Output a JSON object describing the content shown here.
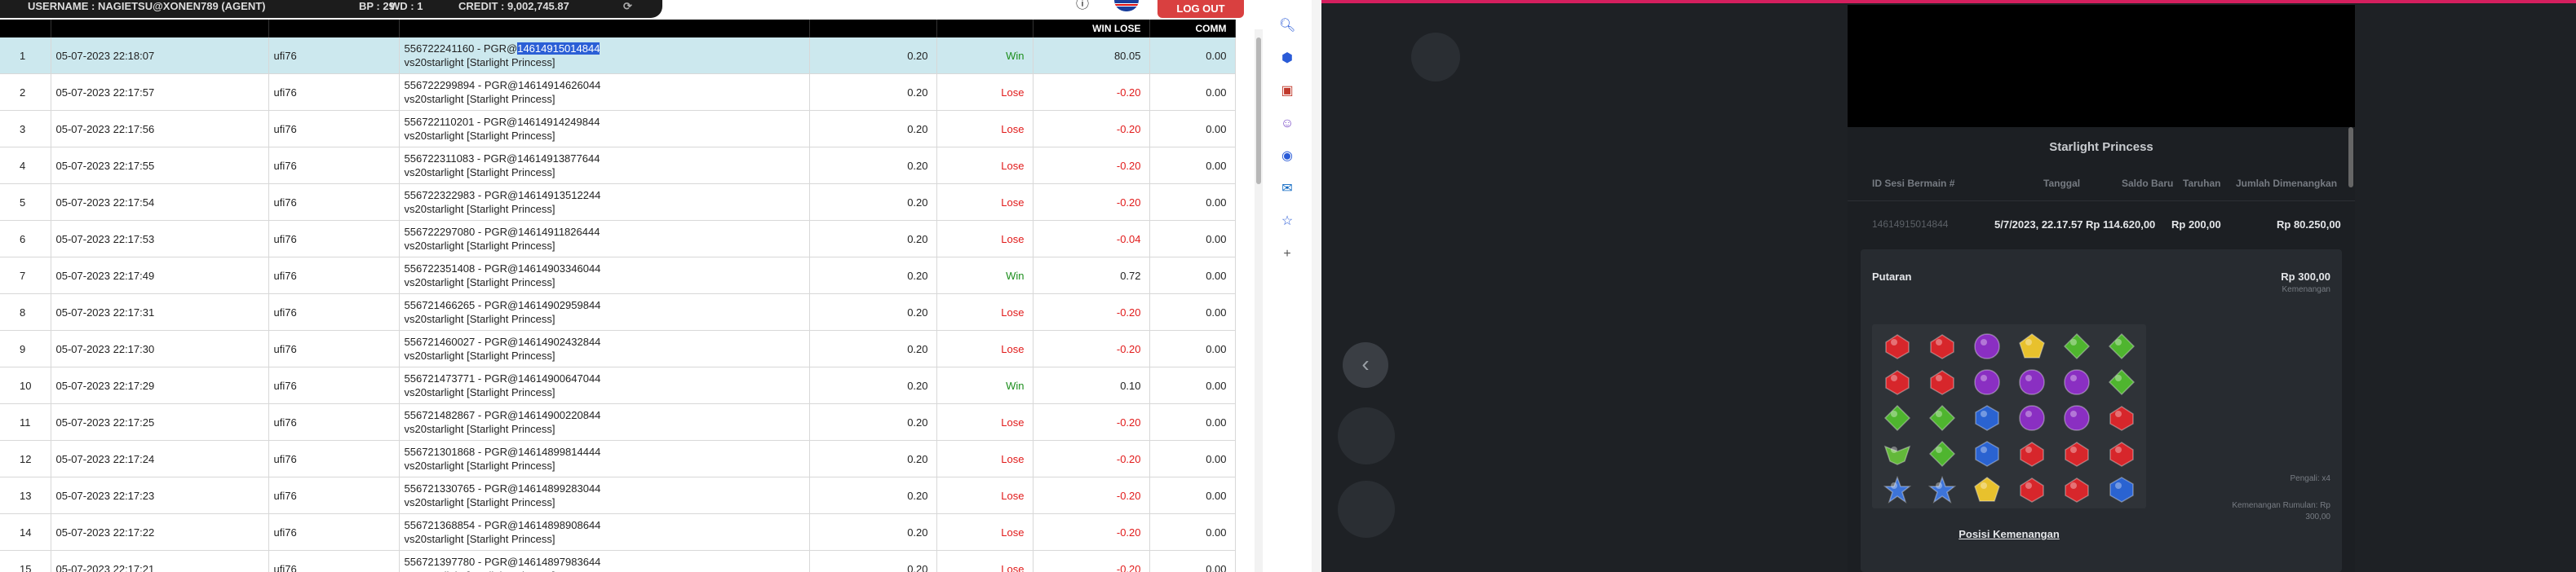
{
  "topbar": {
    "username": "USERNAME : NAGIETSU@XONEN789 (AGENT)",
    "bp": "BP : 29",
    "wd": "WD : 1",
    "credit": "CREDIT : 9,002,745.87",
    "logout_label": "LOG OUT"
  },
  "table": {
    "headers": [
      "",
      "",
      "",
      "",
      "",
      "",
      "WIN LOSE",
      "COMM"
    ],
    "rows": [
      {
        "no": "1",
        "date": "05-07-2023 22:18:07",
        "user": "ufi76",
        "txn_prefix": "556722241160 - PGR@",
        "txn_hl": "14614915014844",
        "game": "vs20starlight [Starlight Princess]",
        "bet": "0.20",
        "result": "Win",
        "winlose": "80.05",
        "comm": "0.00"
      },
      {
        "no": "2",
        "date": "05-07-2023 22:17:57",
        "user": "ufi76",
        "txn": "556722299894 - PGR@14614914626044",
        "game": "vs20starlight [Starlight Princess]",
        "bet": "0.20",
        "result": "Lose",
        "winlose": "-0.20",
        "comm": "0.00"
      },
      {
        "no": "3",
        "date": "05-07-2023 22:17:56",
        "user": "ufi76",
        "txn": "556722110201 - PGR@14614914249844",
        "game": "vs20starlight [Starlight Princess]",
        "bet": "0.20",
        "result": "Lose",
        "winlose": "-0.20",
        "comm": "0.00"
      },
      {
        "no": "4",
        "date": "05-07-2023 22:17:55",
        "user": "ufi76",
        "txn": "556722311083 - PGR@14614913877644",
        "game": "vs20starlight [Starlight Princess]",
        "bet": "0.20",
        "result": "Lose",
        "winlose": "-0.20",
        "comm": "0.00"
      },
      {
        "no": "5",
        "date": "05-07-2023 22:17:54",
        "user": "ufi76",
        "txn": "556722322983 - PGR@14614913512244",
        "game": "vs20starlight [Starlight Princess]",
        "bet": "0.20",
        "result": "Lose",
        "winlose": "-0.20",
        "comm": "0.00"
      },
      {
        "no": "6",
        "date": "05-07-2023 22:17:53",
        "user": "ufi76",
        "txn": "556722297080 - PGR@14614911826444",
        "game": "vs20starlight [Starlight Princess]",
        "bet": "0.20",
        "result": "Lose",
        "winlose": "-0.04",
        "comm": "0.00"
      },
      {
        "no": "7",
        "date": "05-07-2023 22:17:49",
        "user": "ufi76",
        "txn": "556722351408 - PGR@14614903346044",
        "game": "vs20starlight [Starlight Princess]",
        "bet": "0.20",
        "result": "Win",
        "winlose": "0.72",
        "comm": "0.00"
      },
      {
        "no": "8",
        "date": "05-07-2023 22:17:31",
        "user": "ufi76",
        "txn": "556721466265 - PGR@14614902959844",
        "game": "vs20starlight [Starlight Princess]",
        "bet": "0.20",
        "result": "Lose",
        "winlose": "-0.20",
        "comm": "0.00"
      },
      {
        "no": "9",
        "date": "05-07-2023 22:17:30",
        "user": "ufi76",
        "txn": "556721460027 - PGR@14614902432844",
        "game": "vs20starlight [Starlight Princess]",
        "bet": "0.20",
        "result": "Lose",
        "winlose": "-0.20",
        "comm": "0.00"
      },
      {
        "no": "10",
        "date": "05-07-2023 22:17:29",
        "user": "ufi76",
        "txn": "556721473771 - PGR@14614900647044",
        "game": "vs20starlight [Starlight Princess]",
        "bet": "0.20",
        "result": "Win",
        "winlose": "0.10",
        "comm": "0.00"
      },
      {
        "no": "11",
        "date": "05-07-2023 22:17:25",
        "user": "ufi76",
        "txn": "556721482867 - PGR@14614900220844",
        "game": "vs20starlight [Starlight Princess]",
        "bet": "0.20",
        "result": "Lose",
        "winlose": "-0.20",
        "comm": "0.00"
      },
      {
        "no": "12",
        "date": "05-07-2023 22:17:24",
        "user": "ufi76",
        "txn": "556721301868 - PGR@14614899814444",
        "game": "vs20starlight [Starlight Princess]",
        "bet": "0.20",
        "result": "Lose",
        "winlose": "-0.20",
        "comm": "0.00"
      },
      {
        "no": "13",
        "date": "05-07-2023 22:17:23",
        "user": "ufi76",
        "txn": "556721330765 - PGR@14614899283044",
        "game": "vs20starlight [Starlight Princess]",
        "bet": "0.20",
        "result": "Lose",
        "winlose": "-0.20",
        "comm": "0.00"
      },
      {
        "no": "14",
        "date": "05-07-2023 22:17:22",
        "user": "ufi76",
        "txn": "556721368854 - PGR@14614898908644",
        "game": "vs20starlight [Starlight Princess]",
        "bet": "0.20",
        "result": "Lose",
        "winlose": "-0.20",
        "comm": "0.00"
      },
      {
        "no": "15",
        "date": "05-07-2023 22:17:21",
        "user": "ufi76",
        "txn": "556721397780 - PGR@14614897983644",
        "game": "vs20starlight [Starlight Princess]",
        "bet": "0.20",
        "result": "Lose",
        "winlose": "-0.20",
        "comm": "0.00"
      }
    ]
  },
  "sidebar_icons": [
    "search-icon",
    "tag-icon",
    "toolbox-icon",
    "people-icon",
    "office-icon",
    "outlook-icon",
    "cart-icon",
    "add-icon"
  ],
  "game": {
    "title": "Starlight Princess",
    "columns": {
      "session_id": "ID Sesi Bermain #",
      "date": "Tanggal",
      "balance": "Saldo Baru",
      "bet": "Taruhan",
      "won": "Jumlah Dimenangkan"
    },
    "row": {
      "session_id": "14614915014844",
      "date": "5/7/2023, 22.17.57",
      "balance": "Rp 114.620,00",
      "bet": "Rp 200,00",
      "won": "Rp 80.250,00"
    },
    "spin_label": "Putaran",
    "spin_amount": "Rp 300,00",
    "spin_win_label": "Kemenangan",
    "multiplier_label": "Pengali: x4",
    "total_win_label": "Kemenangan Rumulan: Rp 300,00",
    "win_position_link": "Posisi Kemenangan",
    "reels": [
      [
        "red-heart",
        "red-heart",
        "purple-crescent",
        "yellow-pentagon",
        "green-gem",
        "green-gem"
      ],
      [
        "red-heart",
        "red-heart",
        "purple-crescent",
        "purple-crescent",
        "purple-crescent",
        "green-gem"
      ],
      [
        "green-gem",
        "green-gem",
        "blue-hexagon",
        "purple-crescent",
        "purple-crescent",
        "red-heart"
      ],
      [
        "green-wings",
        "green-gem",
        "blue-hexagon",
        "red-heart",
        "red-heart",
        "red-heart"
      ],
      [
        "blue-star",
        "blue-star",
        "yellow-pentagon",
        "red-heart",
        "red-heart",
        "blue-hexagon"
      ]
    ]
  },
  "colors": {
    "win": "#1c8e1c",
    "lose": "#e11a1a",
    "selected_row": "#cce8ee",
    "header": "#000000",
    "logout": "#d94040",
    "accent_bar": "#d41f5e"
  }
}
